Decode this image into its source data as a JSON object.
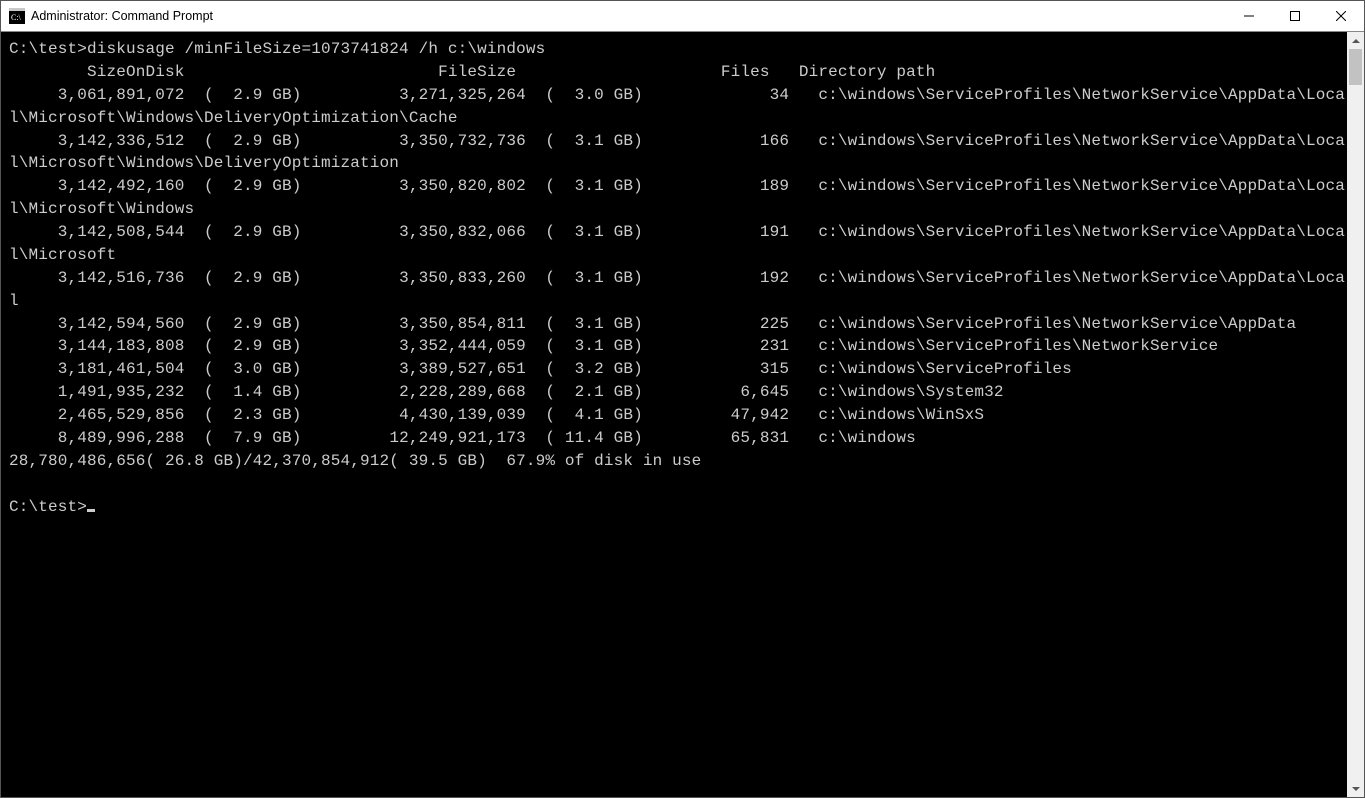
{
  "title": "Administrator: Command Prompt",
  "prompt1": "C:\\test>",
  "command": "diskusage /minFileSize=1073741824 /h c:\\windows",
  "header": "        SizeOnDisk                          FileSize                     Files   Directory path",
  "rows": [
    {
      "sod": "3,061,891,072",
      "sodh": "2.9 GB",
      "fs": "3,271,325,264",
      "fsh": "3.0 GB",
      "files": "34",
      "path": "c:\\windows\\ServiceProfiles\\NetworkService\\AppData\\Local\\Microsoft\\Windows\\DeliveryOptimization\\Cache"
    },
    {
      "sod": "3,142,336,512",
      "sodh": "2.9 GB",
      "fs": "3,350,732,736",
      "fsh": "3.1 GB",
      "files": "166",
      "path": "c:\\windows\\ServiceProfiles\\NetworkService\\AppData\\Local\\Microsoft\\Windows\\DeliveryOptimization"
    },
    {
      "sod": "3,142,492,160",
      "sodh": "2.9 GB",
      "fs": "3,350,820,802",
      "fsh": "3.1 GB",
      "files": "189",
      "path": "c:\\windows\\ServiceProfiles\\NetworkService\\AppData\\Local\\Microsoft\\Windows"
    },
    {
      "sod": "3,142,508,544",
      "sodh": "2.9 GB",
      "fs": "3,350,832,066",
      "fsh": "3.1 GB",
      "files": "191",
      "path": "c:\\windows\\ServiceProfiles\\NetworkService\\AppData\\Local\\Microsoft"
    },
    {
      "sod": "3,142,516,736",
      "sodh": "2.9 GB",
      "fs": "3,350,833,260",
      "fsh": "3.1 GB",
      "files": "192",
      "path": "c:\\windows\\ServiceProfiles\\NetworkService\\AppData\\Local"
    },
    {
      "sod": "3,142,594,560",
      "sodh": "2.9 GB",
      "fs": "3,350,854,811",
      "fsh": "3.1 GB",
      "files": "225",
      "path": "c:\\windows\\ServiceProfiles\\NetworkService\\AppData"
    },
    {
      "sod": "3,144,183,808",
      "sodh": "2.9 GB",
      "fs": "3,352,444,059",
      "fsh": "3.1 GB",
      "files": "231",
      "path": "c:\\windows\\ServiceProfiles\\NetworkService"
    },
    {
      "sod": "3,181,461,504",
      "sodh": "3.0 GB",
      "fs": "3,389,527,651",
      "fsh": "3.2 GB",
      "files": "315",
      "path": "c:\\windows\\ServiceProfiles"
    },
    {
      "sod": "1,491,935,232",
      "sodh": "1.4 GB",
      "fs": "2,228,289,668",
      "fsh": "2.1 GB",
      "files": "6,645",
      "path": "c:\\windows\\System32"
    },
    {
      "sod": "2,465,529,856",
      "sodh": "2.3 GB",
      "fs": "4,430,139,039",
      "fsh": "4.1 GB",
      "files": "47,942",
      "path": "c:\\windows\\WinSxS"
    },
    {
      "sod": "8,489,996,288",
      "sodh": "7.9 GB",
      "fs": "12,249,921,173",
      "fsh": "11.4 GB",
      "files": "65,831",
      "path": "c:\\windows"
    }
  ],
  "summary": "28,780,486,656( 26.8 GB)/42,370,854,912( 39.5 GB)  67.9% of disk in use",
  "prompt2": "C:\\test>"
}
